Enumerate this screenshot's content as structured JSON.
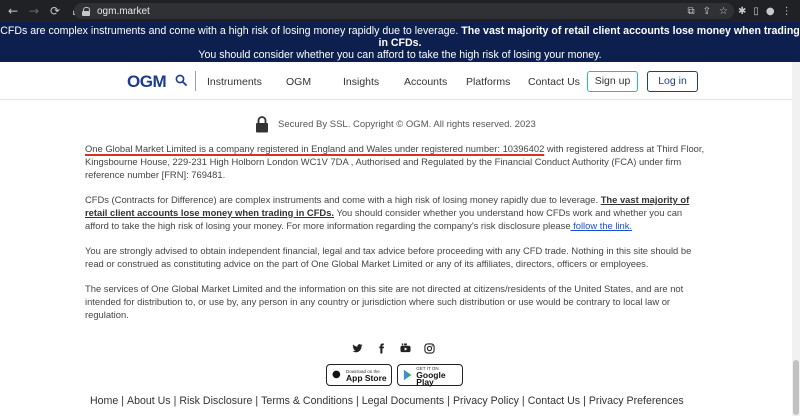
{
  "browser": {
    "url": "ogm.market"
  },
  "banner": {
    "line1_normal": "CFDs are complex instruments and come with a high risk of losing money rapidly due to leverage.",
    "line1_bold": "The vast majority of retail client accounts lose money when trading in CFDs.",
    "line2": "You should consider whether you can afford to take the high risk of losing your money."
  },
  "header": {
    "logo": "OGM",
    "nav": [
      "Instruments",
      "OGM",
      "Insights",
      "Accounts",
      "Platforms",
      "Contact Us"
    ],
    "signup": "Sign up",
    "login": "Log in"
  },
  "ssl": {
    "text": "Secured By SSL. Copyright © OGM. All rights reserved. 2023"
  },
  "legal": {
    "p1_underlined": "One Global Market Limited is a company registered in England and Wales under registered number: 10396402",
    "p1_rest": " with registered address at Third Floor, Kingsbourne House, 229-231 High Holborn London WC1V 7DA , Authorised and Regulated by the Financial Conduct Authority (FCA) under firm reference number [FRN]: 769481.",
    "p2_start": "CFDs (Contracts for Difference) are complex instruments and come with a high risk of losing money rapidly due to leverage.",
    "p2_bold": "The vast majority of retail client accounts lose money when trading in CFDs.",
    "p2_rest": " You should consider whether you understand how CFDs work and whether you can afford to take the high risk of losing your money. For more information regarding the company's risk disclosure please",
    "p2_link": " follow the link.",
    "p3": "You are strongly advised to obtain independent financial, legal and tax advice before proceeding with any CFD trade. Nothing in this site should be read or construed as constituting advice on the part of One Global Market Limited or any of its affiliates, directors, officers or employees.",
    "p4": "The services of One Global Market Limited and the information on this site are not directed at citizens/residents of the United States, and are not intended for distribution to, or use by, any person in any country or jurisdiction where such distribution or use would be contrary to local law or regulation."
  },
  "social": [
    "twitter-icon",
    "facebook-icon",
    "youtube-icon",
    "instagram-icon"
  ],
  "badges": {
    "appstore_small": "Download on the",
    "appstore_big": "App Store",
    "googleplay_small": "GET IT ON",
    "googleplay_big": "Google Play"
  },
  "footer": [
    "Home",
    "About Us",
    "Risk Disclosure",
    "Terms & Conditions",
    "Legal Documents",
    "Privacy Policy",
    "Contact Us",
    "Privacy Preferences"
  ],
  "colors": {
    "banner_bg": "#0d1f4f",
    "brand": "#1d3c8f",
    "signup_border": "#27c1a9",
    "link": "#1a4fd8",
    "annotation_red": "#d93025"
  }
}
